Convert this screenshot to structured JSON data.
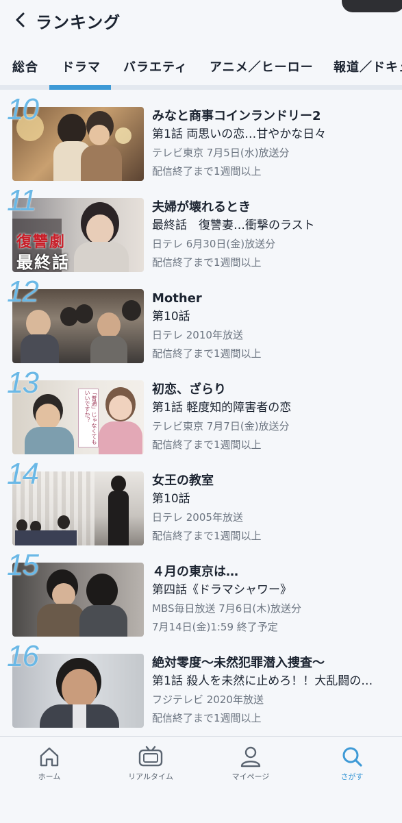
{
  "header": {
    "title": "ランキング",
    "back_icon": "chevron-left-icon"
  },
  "tabs": [
    {
      "label": "総合"
    },
    {
      "label": "ドラマ",
      "active": true
    },
    {
      "label": "バラエティ"
    },
    {
      "label": "アニメ／ヒーロー"
    },
    {
      "label": "報道／ドキュ"
    }
  ],
  "items": [
    {
      "rank": "10",
      "title": "みなと商事コインランドリー2",
      "episode": "第1話 両思いの恋…甘やかな日々",
      "broadcast": "テレビ東京 7月5日(水)放送分",
      "availability": "配信終了まで1週間以上"
    },
    {
      "rank": "11",
      "title": "夫婦が壊れるとき",
      "episode": "最終話　復讐妻…衝撃のラスト",
      "broadcast": "日テレ 6月30日(金)放送分",
      "availability": "配信終了まで1週間以上",
      "thumb_text_1": "復讐劇",
      "thumb_text_2": "最終話"
    },
    {
      "rank": "12",
      "title": "Mother",
      "episode": "第10話",
      "broadcast": "日テレ 2010年放送",
      "availability": "配信終了まで1週間以上"
    },
    {
      "rank": "13",
      "title": "初恋、ざらり",
      "episode": "第1話 軽度知的障害者の恋",
      "broadcast": "テレビ東京 7月7日(金)放送分",
      "availability": "配信終了まで1週間以上",
      "thumb_text_1": "「普通」じゃなくても いいですか？"
    },
    {
      "rank": "14",
      "title": "女王の教室",
      "episode": "第10話",
      "broadcast": "日テレ 2005年放送",
      "availability": "配信終了まで1週間以上"
    },
    {
      "rank": "15",
      "title": "４月の東京は…",
      "episode": "第四話《ドラマシャワー》",
      "broadcast": "MBS毎日放送 7月6日(木)放送分",
      "availability": "7月14日(金)1:59 終了予定"
    },
    {
      "rank": "16",
      "title": "絶対零度〜未然犯罪潜入捜査〜",
      "episode": "第1話 殺人を未然に止めろ！！大乱闘の…",
      "broadcast": "フジテレビ 2020年放送",
      "availability": "配信終了まで1週間以上"
    }
  ],
  "bottom_nav": [
    {
      "label": "ホーム",
      "icon": "home-icon"
    },
    {
      "label": "リアルタイム",
      "icon": "tv-icon"
    },
    {
      "label": "マイページ",
      "icon": "user-icon"
    },
    {
      "label": "さがす",
      "icon": "search-icon",
      "active": true
    }
  ],
  "colors": {
    "accent": "#3e9ad6",
    "rank": "#6ab8e6",
    "text": "#1b2330",
    "subtext": "#6b7480"
  }
}
